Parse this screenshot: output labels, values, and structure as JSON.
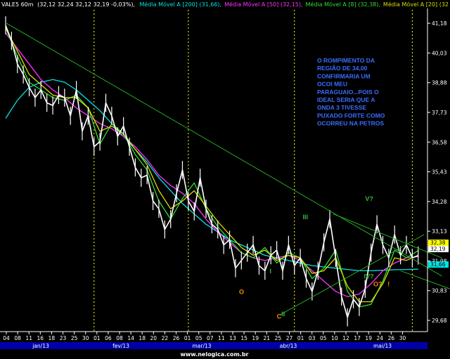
{
  "header": {
    "symbol": "VALE5 60m",
    "ohlc": "(32,12  32,24  32,12  32,19  -0,03%),",
    "mas": [
      {
        "label": "Média Móvel A [200]",
        "value": "(31,66),",
        "color": "#00e5e5"
      },
      {
        "label": "Média Móvel A [50]",
        "value": "(32,15),",
        "color": "#ff33ff"
      },
      {
        "label": "Média Móvel A [8]",
        "value": "(32,38),",
        "color": "#33dd33"
      },
      {
        "label": "Média Móvel A [20]",
        "value": "(32",
        "color": "#dddd00"
      }
    ]
  },
  "annotation": {
    "lines": [
      "O ROMPIMENTO DA",
      "REGIÃO DE 34,00",
      "CONFIRMARIA UM",
      "OCOI MEU",
      "PARAGUAIO...POIS O",
      "IDEAL SERIA QUE A",
      "ONDA 3 TIVESSE",
      "PUXADO FORTE COMO",
      "OCORREU NA PETROS"
    ],
    "color": "#3b6cff"
  },
  "wave_labels": [
    {
      "text": "V?",
      "x": 30.5,
      "y": 34.3,
      "color": "#33bb33"
    },
    {
      "text": "III",
      "x": 25.2,
      "y": 33.6,
      "color": "#33bb33"
    },
    {
      "text": "I",
      "x": 22.4,
      "y": 31.5,
      "color": "#33bb33"
    },
    {
      "text": "IV?",
      "x": 30.4,
      "y": 31.3,
      "color": "#33bb33"
    },
    {
      "text": "II",
      "x": 23.4,
      "y": 29.85,
      "color": "#33bb33"
    },
    {
      "text": "O?",
      "x": 31.2,
      "y": 31.0,
      "color": "#ff8c00"
    },
    {
      "text": "!",
      "x": 32.4,
      "y": 31.0,
      "color": "#ff8c00"
    },
    {
      "text": "O",
      "x": 19.8,
      "y": 30.7,
      "color": "#ff8c00"
    },
    {
      "text": "C",
      "x": 23.0,
      "y": 29.75,
      "color": "#ff8c00"
    }
  ],
  "badges": [
    {
      "text": "32,38",
      "value": 32.38,
      "bg": "#ffff00",
      "fg": "#000000"
    },
    {
      "text": "32,19",
      "value": 32.19,
      "bg": "#ffffff",
      "fg": "#000000"
    },
    {
      "text": "31,66",
      "value": 31.66,
      "bg": "#00e5e5",
      "fg": "#000000"
    }
  ],
  "footer": "www.nelogica.com.br",
  "chart_data": {
    "type": "line",
    "y_ticks": [
      "41,18",
      "40,03",
      "38,88",
      "37,73",
      "36,58",
      "35,43",
      "34,28",
      "33,13",
      "31,98",
      "30,83",
      "29,68"
    ],
    "ylim": [
      29.3,
      41.7
    ],
    "xlim": [
      0,
      34
    ],
    "x_ticks": [
      {
        "label": "04",
        "i": 0
      },
      {
        "label": "08",
        "i": 1
      },
      {
        "label": "11",
        "i": 2
      },
      {
        "label": "16",
        "i": 3
      },
      {
        "label": "18",
        "i": 4
      },
      {
        "label": "23",
        "i": 5
      },
      {
        "label": "25",
        "i": 6
      },
      {
        "label": "30",
        "i": 7
      },
      {
        "label": "01",
        "i": 8
      },
      {
        "label": "06",
        "i": 9
      },
      {
        "label": "08",
        "i": 10
      },
      {
        "label": "14",
        "i": 11
      },
      {
        "label": "18",
        "i": 12
      },
      {
        "label": "20",
        "i": 13
      },
      {
        "label": "22",
        "i": 14
      },
      {
        "label": "26",
        "i": 15
      },
      {
        "label": "01",
        "i": 16
      },
      {
        "label": "05",
        "i": 17
      },
      {
        "label": "07",
        "i": 18
      },
      {
        "label": "11",
        "i": 19
      },
      {
        "label": "13",
        "i": 20
      },
      {
        "label": "15",
        "i": 21
      },
      {
        "label": "19",
        "i": 22
      },
      {
        "label": "21",
        "i": 23
      },
      {
        "label": "25",
        "i": 24
      },
      {
        "label": "27",
        "i": 25
      },
      {
        "label": "01",
        "i": 26
      },
      {
        "label": "03",
        "i": 27
      },
      {
        "label": "05",
        "i": 28
      },
      {
        "label": "10",
        "i": 29
      },
      {
        "label": "12",
        "i": 30
      },
      {
        "label": "17",
        "i": 31
      },
      {
        "label": "19",
        "i": 32
      },
      {
        "label": "24",
        "i": 33
      },
      {
        "label": "26",
        "i": 34
      },
      {
        "label": "30",
        "i": 35
      }
    ],
    "months": [
      {
        "label": "jan/13",
        "from": 0,
        "to": 7.5
      },
      {
        "label": "fev/13",
        "from": 7.5,
        "to": 15.5
      },
      {
        "label": "mar/13",
        "from": 15.5,
        "to": 24.5
      },
      {
        "label": "abr/13",
        "from": 24.5,
        "to": 34.5
      },
      {
        "label": "mai/13",
        "from": 34.5,
        "to": 40
      }
    ],
    "month_dividers": [
      7.5,
      15.5,
      24.5,
      34.5
    ],
    "series": [
      {
        "name": "Média Móvel A [200]",
        "color": "#00e5e5",
        "x": [
          0,
          1,
          2,
          3,
          4,
          5,
          6,
          7,
          8,
          9,
          10,
          11,
          12,
          13,
          14,
          15,
          16,
          17,
          18,
          19,
          20,
          21,
          22,
          23,
          24,
          25,
          26,
          27,
          28,
          29,
          30,
          31,
          32,
          33,
          34,
          35
        ],
        "y": [
          37.5,
          38.2,
          38.7,
          38.9,
          39.0,
          38.9,
          38.6,
          38.2,
          37.8,
          37.3,
          36.8,
          36.3,
          35.8,
          35.2,
          34.7,
          34.2,
          33.8,
          33.4,
          33.1,
          32.8,
          32.6,
          32.4,
          32.2,
          32.1,
          32.0,
          31.9,
          31.8,
          31.75,
          31.7,
          31.65,
          31.6,
          31.6,
          31.62,
          31.64,
          31.65,
          31.66
        ]
      },
      {
        "name": "Média Móvel A [50]",
        "color": "#ff33ff",
        "x": [
          0,
          1,
          2,
          3,
          4,
          5,
          6,
          7,
          8,
          9,
          10,
          11,
          12,
          13,
          14,
          15,
          16,
          17,
          18,
          19,
          20,
          21,
          22,
          23,
          24,
          25,
          26,
          27,
          28,
          29,
          30,
          31,
          32,
          33,
          34,
          35
        ],
        "y": [
          40.8,
          40.2,
          39.6,
          39.0,
          38.6,
          38.3,
          37.9,
          37.6,
          37.3,
          37.1,
          36.8,
          36.4,
          35.9,
          35.3,
          34.9,
          34.6,
          34.2,
          33.6,
          33.1,
          32.7,
          32.3,
          32.1,
          32.0,
          32.1,
          32.2,
          32.0,
          31.6,
          31.2,
          30.8,
          30.6,
          30.7,
          31.1,
          31.6,
          31.9,
          32.1,
          32.15
        ]
      },
      {
        "name": "Média Móvel A [8]",
        "color": "#33dd33",
        "x": [
          0,
          1,
          2,
          3,
          4,
          5,
          6,
          7,
          8,
          9,
          10,
          11,
          12,
          13,
          14,
          15,
          16,
          17,
          18,
          19,
          20,
          21,
          22,
          23,
          24,
          25,
          26,
          27,
          28,
          29,
          30,
          31,
          32,
          33,
          34,
          35
        ],
        "y": [
          41.0,
          39.9,
          38.9,
          38.6,
          38.3,
          38.2,
          38.4,
          37.9,
          36.5,
          37.3,
          36.9,
          36.1,
          35.5,
          34.3,
          33.6,
          34.4,
          35.0,
          34.0,
          33.3,
          32.8,
          32.3,
          32.1,
          32.5,
          31.9,
          32.3,
          32.1,
          31.3,
          31.7,
          32.4,
          30.8,
          30.2,
          30.3,
          31.2,
          32.4,
          32.1,
          32.38
        ]
      },
      {
        "name": "Média Móvel A [20]",
        "color": "#dddd00",
        "x": [
          0,
          1,
          2,
          3,
          4,
          5,
          6,
          7,
          8,
          9,
          10,
          11,
          12,
          13,
          14,
          15,
          16,
          17,
          18,
          19,
          20,
          21,
          22,
          23,
          24,
          25,
          26,
          27,
          28,
          29,
          30,
          31,
          32,
          33,
          34,
          35
        ],
        "y": [
          41.0,
          40.1,
          39.2,
          38.8,
          38.4,
          38.3,
          38.3,
          37.9,
          37.0,
          37.2,
          36.9,
          36.3,
          35.7,
          34.7,
          34.0,
          34.3,
          34.7,
          34.1,
          33.5,
          33.0,
          32.5,
          32.2,
          32.4,
          32.0,
          32.2,
          32.1,
          31.5,
          31.6,
          32.1,
          31.0,
          30.4,
          30.4,
          31.1,
          32.1,
          32.0,
          32.2
        ]
      },
      {
        "name": "VALE5 60m",
        "color": "#ffffff",
        "x": [
          0,
          0.5,
          1,
          1.5,
          2,
          2.5,
          3,
          3.5,
          4,
          4.5,
          5,
          5.5,
          6,
          6.5,
          7,
          7.5,
          8,
          8.5,
          9,
          9.5,
          10,
          10.5,
          11,
          11.5,
          12,
          12.5,
          13,
          13.5,
          14,
          14.5,
          15,
          15.5,
          16,
          16.5,
          17,
          17.5,
          18,
          18.5,
          19,
          19.5,
          20,
          20.5,
          21,
          21.5,
          22,
          22.5,
          23,
          23.5,
          24,
          24.5,
          25,
          25.5,
          26,
          26.5,
          27,
          27.5,
          28,
          28.5,
          29,
          29.5,
          30,
          30.5,
          31,
          31.5,
          32,
          32.5,
          33,
          33.5,
          34,
          34.5,
          35
        ],
        "y": [
          41.1,
          40.5,
          39.6,
          39.2,
          38.7,
          38.3,
          38.6,
          38.1,
          38.0,
          38.4,
          38.3,
          37.6,
          38.6,
          37.0,
          37.6,
          36.4,
          36.6,
          38.1,
          37.6,
          36.8,
          37.2,
          36.4,
          35.6,
          35.2,
          35.3,
          34.3,
          34.0,
          33.2,
          33.6,
          34.6,
          35.5,
          34.3,
          33.9,
          35.2,
          34.0,
          33.4,
          33.2,
          32.6,
          32.8,
          31.7,
          32.0,
          32.3,
          32.6,
          31.8,
          31.6,
          32.2,
          32.4,
          31.6,
          32.6,
          31.8,
          32.1,
          31.3,
          30.8,
          31.6,
          32.7,
          33.6,
          32.1,
          30.6,
          29.8,
          30.5,
          30.2,
          30.9,
          32.3,
          33.4,
          32.6,
          32.1,
          33.0,
          32.2,
          32.6,
          32.1,
          32.19
        ]
      }
    ],
    "trendlines": [
      {
        "x": [
          0,
          37
        ],
        "y": [
          41.2,
          31.4
        ],
        "color": "#22aa22"
      },
      {
        "x": [
          27.8,
          37
        ],
        "y": [
          33.8,
          32.1
        ],
        "color": "#22aa22"
      },
      {
        "x": [
          23.3,
          35.5
        ],
        "y": [
          29.9,
          33.0
        ],
        "color": "#22aa22"
      },
      {
        "x": [
          33.5,
          40
        ],
        "y": [
          31.6,
          30.9
        ],
        "color": "#22aa22"
      }
    ],
    "grid": false,
    "legend": "top"
  }
}
